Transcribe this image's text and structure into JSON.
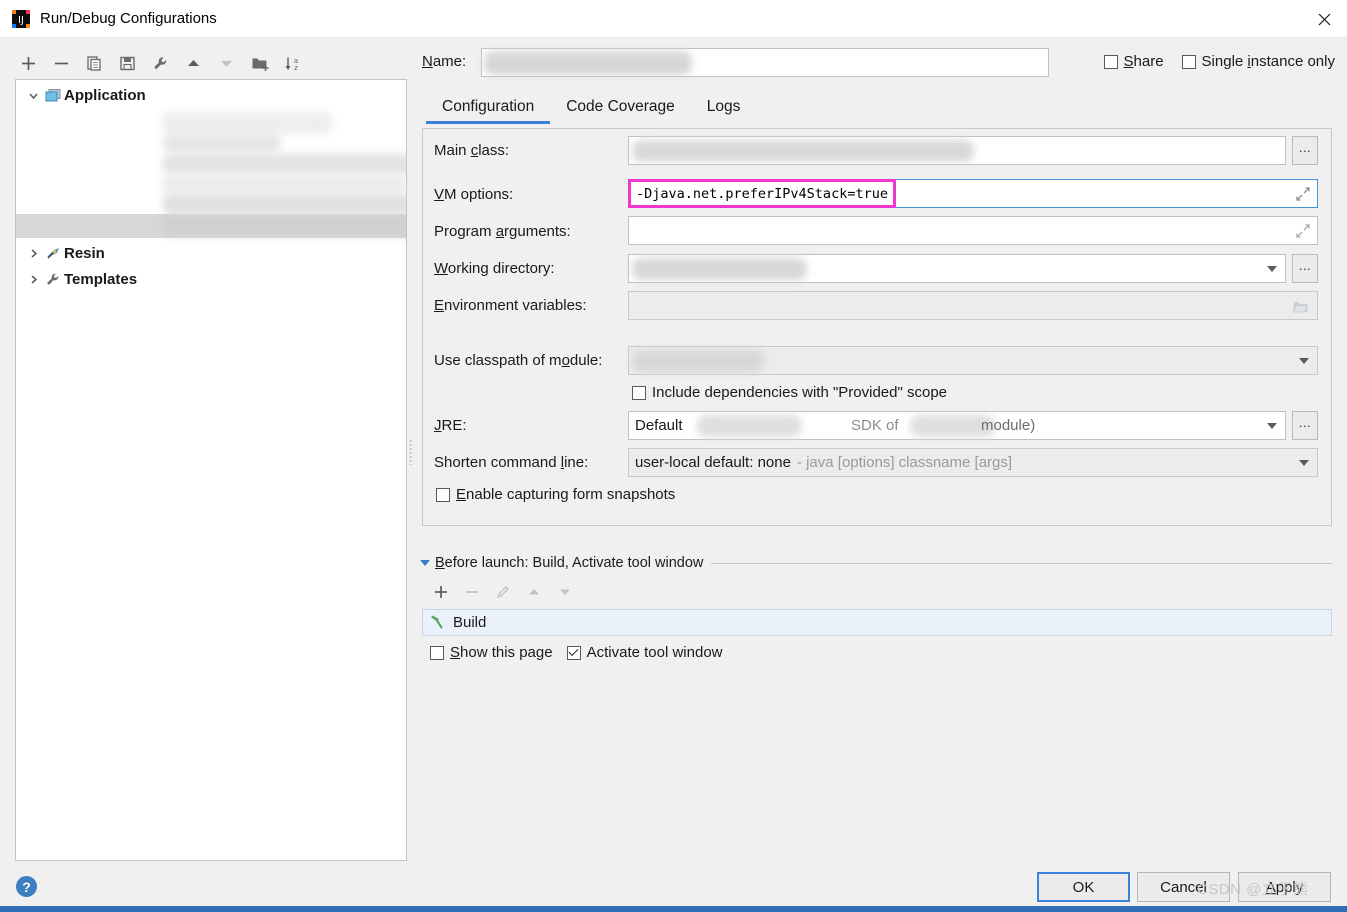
{
  "window": {
    "title": "Run/Debug Configurations",
    "logo_icon": "intellij-idea-logo",
    "close_icon": "close-icon"
  },
  "left_toolbar": {
    "items": [
      {
        "icon": "add-icon",
        "label": "+"
      },
      {
        "icon": "remove-icon",
        "label": "−"
      },
      {
        "icon": "copy-icon",
        "label": "Copy Configuration"
      },
      {
        "icon": "save-icon",
        "label": "Save Configuration"
      },
      {
        "icon": "edit-templates-icon",
        "label": "Edit Templates"
      },
      {
        "icon": "move-up-icon",
        "label": "Move Up"
      },
      {
        "icon": "move-down-icon",
        "label": "Move Down"
      },
      {
        "icon": "new-folder-icon",
        "label": "Create New Folder"
      },
      {
        "icon": "sort-alphabetically-icon",
        "label": "Sort Configurations"
      }
    ]
  },
  "tree": {
    "nodes": [
      {
        "label": "Application",
        "icon": "application-icon",
        "expanded": true,
        "bold": true
      },
      {
        "label": "Resin",
        "icon": "resin-icon",
        "expanded": false,
        "bold": true
      },
      {
        "label": "Templates",
        "icon": "templates-wrench-icon",
        "expanded": false,
        "bold": true
      }
    ],
    "redacted_children_count": 6
  },
  "name": {
    "label": "Name:",
    "mnemonic": "N",
    "value": "",
    "redacted": true
  },
  "options": {
    "share": {
      "label": "Share",
      "mnemonic": "S",
      "checked": false
    },
    "single_instance": {
      "label": "Single instance only",
      "mnemonic": "i",
      "checked": false
    }
  },
  "tabs": [
    {
      "label": "Configuration",
      "active": true
    },
    {
      "label": "Code Coverage",
      "active": false
    },
    {
      "label": "Logs",
      "active": false
    }
  ],
  "configuration": {
    "main_class": {
      "label": "Main class:",
      "mnemonic": "c",
      "value": "",
      "redacted": true,
      "browse_label": "..."
    },
    "vm_options": {
      "label": "VM options:",
      "mnemonic": "V",
      "value": "-Djava.net.preferIPv4Stack=true",
      "highlight_color": "#ef38d0",
      "focus_color": "#4a90d9",
      "expand_icon": "expand-editor-icon"
    },
    "program_arguments": {
      "label": "Program arguments:",
      "mnemonic": "a",
      "value": "",
      "expand_icon": "expand-editor-icon"
    },
    "working_directory": {
      "label": "Working directory:",
      "mnemonic": "W",
      "value": "",
      "redacted": true,
      "browse_label": "..."
    },
    "environment_variables": {
      "label": "Environment variables:",
      "mnemonic": "E",
      "value": "",
      "folder_icon": "folder-icon",
      "disabled": true
    },
    "use_classpath_of_module": {
      "label": "Use classpath of module:",
      "mnemonic": "o",
      "value": "",
      "redacted": true,
      "disabled": true
    },
    "include_provided": {
      "label": "Include dependencies with \"Provided\" scope",
      "checked": false
    },
    "jre": {
      "label": "JRE:",
      "mnemonic": "J",
      "value_prefix": "Default",
      "value_mid": "SDK of",
      "value_suffix": "module)",
      "redacted": true,
      "browse_label": "..."
    },
    "shorten_command_line": {
      "label": "Shorten command line:",
      "mnemonic": "l",
      "value": "user-local default: none",
      "value_hint": "- java [options] classname [args]",
      "disabled": true
    },
    "enable_capturing": {
      "label": "Enable capturing form snapshots",
      "mnemonic": "E",
      "checked": false
    }
  },
  "before_launch": {
    "title": "Before launch: Build, Activate tool window",
    "mnemonic": "B",
    "expanded": true,
    "toolbar": [
      {
        "icon": "add-icon",
        "enabled": true
      },
      {
        "icon": "remove-icon",
        "enabled": false
      },
      {
        "icon": "edit-pencil-icon",
        "enabled": false
      },
      {
        "icon": "move-up-icon",
        "enabled": false
      },
      {
        "icon": "move-down-icon",
        "enabled": false
      }
    ],
    "tasks": [
      {
        "label": "Build",
        "icon": "build-hammer-icon",
        "selected": true
      }
    ],
    "show_this_page": {
      "label": "Show this page",
      "mnemonic": "S",
      "checked": false
    },
    "activate_tool_window": {
      "label": "Activate tool window",
      "checked": true
    }
  },
  "footer": {
    "help_icon": "help-question-icon",
    "buttons": [
      {
        "label": "OK",
        "primary": true
      },
      {
        "label": "Cancel",
        "primary": false
      },
      {
        "label": "Apply",
        "primary": false,
        "mnemonic": "A"
      }
    ],
    "watermark": "CSDN @立于熊"
  }
}
